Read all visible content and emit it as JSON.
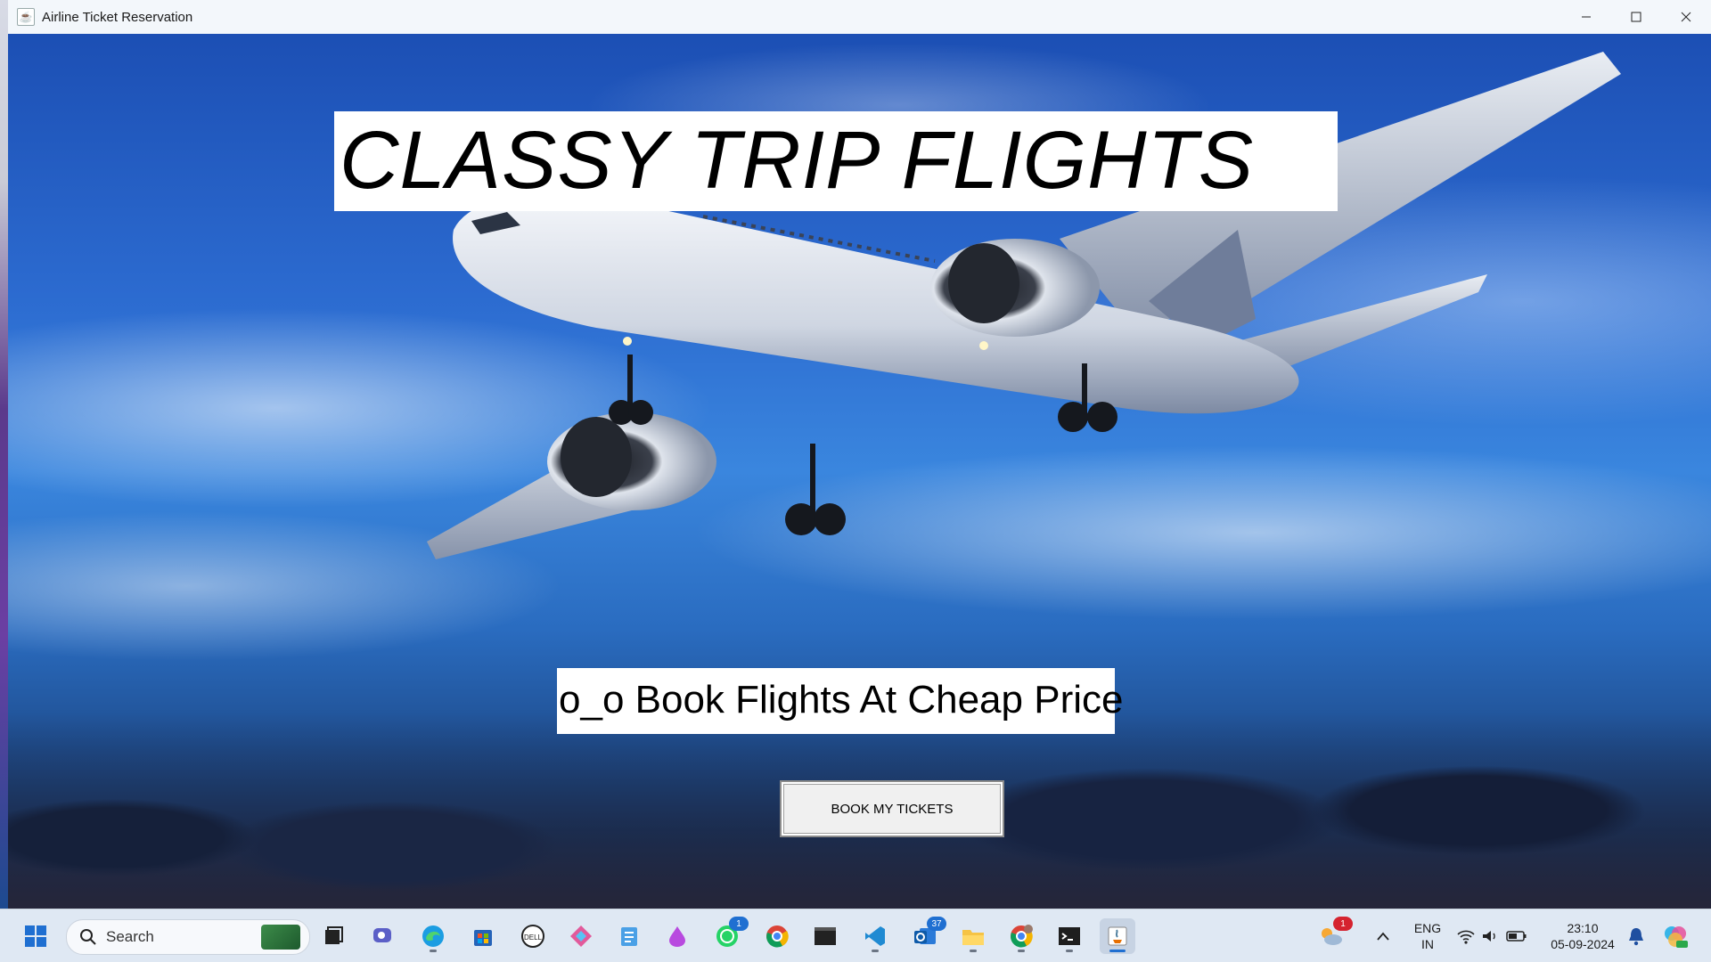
{
  "window": {
    "title": "Airline Ticket Reservation",
    "controls": {
      "minimize": "—",
      "maximize": "☐",
      "close": "✕"
    }
  },
  "hero": {
    "brand_title": "CLASSY TRIP FLIGHTS",
    "tagline": "o_o Book Flights At Cheap Price",
    "book_button_label": "BOOK MY TICKETS"
  },
  "taskbar": {
    "search_label": "Search",
    "apps": [
      {
        "name": "start-button",
        "icon": "windows-logo"
      },
      {
        "name": "file-explorer-task-view",
        "icon": "task-view-icon"
      },
      {
        "name": "teams",
        "icon": "teams-icon"
      },
      {
        "name": "edge",
        "icon": "edge-icon"
      },
      {
        "name": "microsoft-store",
        "icon": "store-icon"
      },
      {
        "name": "dell",
        "icon": "dell-icon"
      },
      {
        "name": "app-diamonds",
        "icon": "diamond-app-icon"
      },
      {
        "name": "notepad",
        "icon": "notepad-icon"
      },
      {
        "name": "paint-drop",
        "icon": "drop-app-icon"
      },
      {
        "name": "whatsapp",
        "icon": "whatsapp-icon",
        "badge": "1"
      },
      {
        "name": "chrome",
        "icon": "chrome-icon"
      },
      {
        "name": "terminal-window",
        "icon": "terminal-icon"
      },
      {
        "name": "vscode",
        "icon": "vscode-icon"
      },
      {
        "name": "outlook",
        "icon": "outlook-icon",
        "badge": "37"
      },
      {
        "name": "file-explorer",
        "icon": "folder-icon"
      },
      {
        "name": "chrome-profile",
        "icon": "chrome-profile-icon"
      },
      {
        "name": "command-prompt",
        "icon": "cmd-icon"
      },
      {
        "name": "java-app",
        "icon": "java-icon"
      }
    ],
    "weather_badge": "1",
    "language": {
      "line1": "ENG",
      "line2": "IN"
    },
    "clock": {
      "time": "23:10",
      "date": "05-09-2024"
    }
  },
  "colors": {
    "sky_top": "#1c4fb4",
    "sky_mid": "#3a86de",
    "taskbar_bg": "#dfe8f3",
    "accent": "#1f6fd1"
  }
}
